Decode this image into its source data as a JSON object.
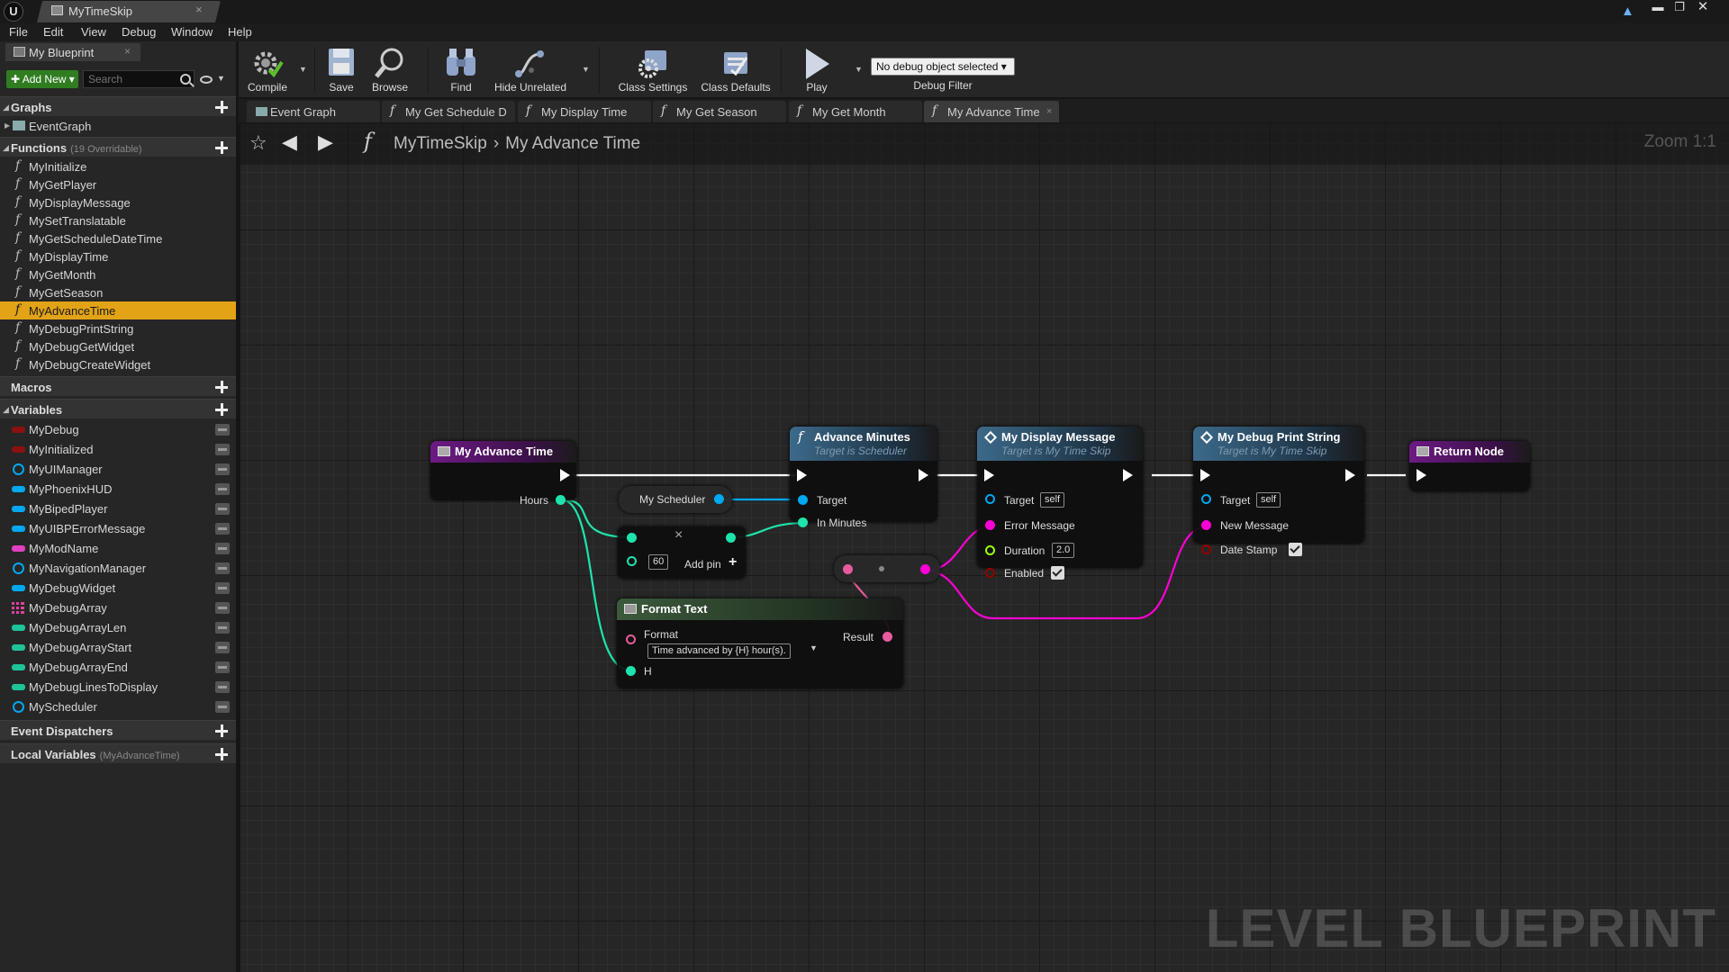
{
  "window": {
    "tab_title": "MyTimeSkip"
  },
  "menu": [
    "File",
    "Edit",
    "View",
    "Debug",
    "Window",
    "Help"
  ],
  "my_blueprint": {
    "tab_label": "My Blueprint",
    "add_new_label": "Add New",
    "search_placeholder": "Search",
    "graphs": {
      "header": "Graphs",
      "items": [
        "EventGraph"
      ]
    },
    "functions": {
      "header": "Functions",
      "overridable": "(19 Overridable)",
      "items": [
        "MyInitialize",
        "MyGetPlayer",
        "MyDisplayMessage",
        "MySetTranslatable",
        "MyGetScheduleDateTime",
        "MyDisplayTime",
        "MyGetMonth",
        "MyGetSeason",
        "MyAdvanceTime",
        "MyDebugPrintString",
        "MyDebugGetWidget",
        "MyDebugCreateWidget"
      ],
      "selected": "MyAdvanceTime"
    },
    "macros": {
      "header": "Macros"
    },
    "variables": {
      "header": "Variables",
      "items": [
        {
          "name": "MyDebug",
          "type_color": "#8b1010",
          "shape": "pill"
        },
        {
          "name": "MyInitialized",
          "type_color": "#8b1010",
          "shape": "pill"
        },
        {
          "name": "MyUIManager",
          "type_color": "#00a8f0",
          "shape": "ring"
        },
        {
          "name": "MyPhoenixHUD",
          "type_color": "#00a8f0",
          "shape": "pill"
        },
        {
          "name": "MyBipedPlayer",
          "type_color": "#00a8f0",
          "shape": "pill"
        },
        {
          "name": "MyUIBPErrorMessage",
          "type_color": "#00a8f0",
          "shape": "pill"
        },
        {
          "name": "MyModName",
          "type_color": "#e040c0",
          "shape": "pill"
        },
        {
          "name": "MyNavigationManager",
          "type_color": "#00a8f0",
          "shape": "ring"
        },
        {
          "name": "MyDebugWidget",
          "type_color": "#00a8f0",
          "shape": "pill"
        },
        {
          "name": "MyDebugArray",
          "type_color": "#e040a0",
          "shape": "grid"
        },
        {
          "name": "MyDebugArrayLen",
          "type_color": "#1fc39a",
          "shape": "pill"
        },
        {
          "name": "MyDebugArrayStart",
          "type_color": "#1fc39a",
          "shape": "pill"
        },
        {
          "name": "MyDebugArrayEnd",
          "type_color": "#1fc39a",
          "shape": "pill"
        },
        {
          "name": "MyDebugLinesToDisplay",
          "type_color": "#1fc39a",
          "shape": "pill"
        },
        {
          "name": "MyScheduler",
          "type_color": "#00a8f0",
          "shape": "ring"
        }
      ]
    },
    "event_dispatchers": {
      "header": "Event Dispatchers"
    },
    "local_variables": {
      "header": "Local Variables",
      "scope": "(MyAdvanceTime)"
    }
  },
  "toolbar": {
    "compile": "Compile",
    "save": "Save",
    "browse": "Browse",
    "find": "Find",
    "hide_unrelated": "Hide Unrelated",
    "class_settings": "Class Settings",
    "class_defaults": "Class Defaults",
    "play": "Play",
    "debug_object": "No debug object selected",
    "debug_filter": "Debug Filter"
  },
  "graph_tabs": [
    "Event Graph",
    "My Get Schedule D",
    "My Display Time",
    "My Get Season",
    "My Get Month",
    "My Advance Time"
  ],
  "active_graph_tab": "My Advance Time",
  "breadcrumb": {
    "root": "MyTimeSkip",
    "current": "My Advance Time"
  },
  "zoom": "Zoom 1:1",
  "watermark": "LEVEL BLUEPRINT",
  "nodes": {
    "entry": {
      "title": "My Advance Time",
      "pin_hours": "Hours",
      "header_color": "#6e1a85"
    },
    "scheduler_var": {
      "label": "My Scheduler"
    },
    "multiply": {
      "value": "60",
      "add_pin": "Add pin"
    },
    "advance_minutes": {
      "title": "Advance Minutes",
      "subtitle": "Target is Scheduler",
      "pin_target": "Target",
      "pin_in_minutes": "In Minutes",
      "header_color": "#3c6a8a"
    },
    "display_message": {
      "title": "My Display Message",
      "subtitle": "Target is My Time Skip",
      "pin_target": "Target",
      "target_value": "self",
      "pin_error": "Error Message",
      "pin_duration": "Duration",
      "duration_value": "2.0",
      "pin_enabled": "Enabled",
      "header_color": "#3c6a8a"
    },
    "debug_print": {
      "title": "My Debug Print String",
      "subtitle": "Target is My Time Skip",
      "pin_target": "Target",
      "target_value": "self",
      "pin_new_message": "New Message",
      "pin_date_stamp": "Date Stamp",
      "header_color": "#3c6a8a"
    },
    "return_node": {
      "title": "Return Node",
      "header_color": "#6e1a85"
    },
    "format_text": {
      "title": "Format Text",
      "pin_format": "Format",
      "format_value": "Time advanced by {H} hour(s).",
      "pin_result": "Result",
      "pin_h": "H",
      "header_color": "#3c5a3c"
    }
  },
  "colors": {
    "exec": "#ffffff",
    "object": "#00a8f0",
    "int": "#1fe3ad",
    "text": "#e75b9c",
    "bool": "#950000",
    "float": "#9dff00",
    "string": "#ff00d4"
  }
}
